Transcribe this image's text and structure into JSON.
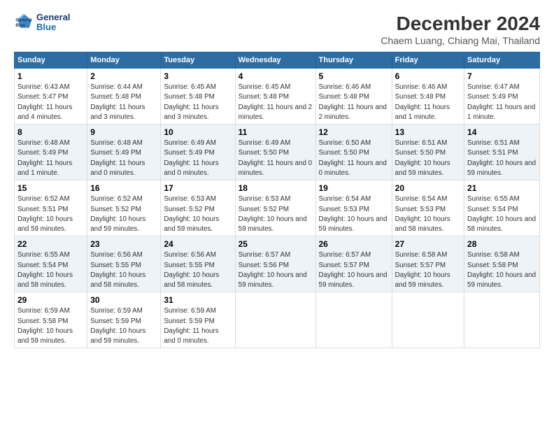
{
  "logo": {
    "line1": "General",
    "line2": "Blue"
  },
  "title": "December 2024",
  "subtitle": "Chaem Luang, Chiang Mai, Thailand",
  "days_header": [
    "Sunday",
    "Monday",
    "Tuesday",
    "Wednesday",
    "Thursday",
    "Friday",
    "Saturday"
  ],
  "weeks": [
    [
      {
        "num": "1",
        "sunrise": "6:43 AM",
        "sunset": "5:47 PM",
        "daylight": "11 hours and 4 minutes."
      },
      {
        "num": "2",
        "sunrise": "6:44 AM",
        "sunset": "5:48 PM",
        "daylight": "11 hours and 3 minutes."
      },
      {
        "num": "3",
        "sunrise": "6:45 AM",
        "sunset": "5:48 PM",
        "daylight": "11 hours and 3 minutes."
      },
      {
        "num": "4",
        "sunrise": "6:45 AM",
        "sunset": "5:48 PM",
        "daylight": "11 hours and 2 minutes."
      },
      {
        "num": "5",
        "sunrise": "6:46 AM",
        "sunset": "5:48 PM",
        "daylight": "11 hours and 2 minutes."
      },
      {
        "num": "6",
        "sunrise": "6:46 AM",
        "sunset": "5:48 PM",
        "daylight": "11 hours and 1 minute."
      },
      {
        "num": "7",
        "sunrise": "6:47 AM",
        "sunset": "5:49 PM",
        "daylight": "11 hours and 1 minute."
      }
    ],
    [
      {
        "num": "8",
        "sunrise": "6:48 AM",
        "sunset": "5:49 PM",
        "daylight": "11 hours and 1 minute."
      },
      {
        "num": "9",
        "sunrise": "6:48 AM",
        "sunset": "5:49 PM",
        "daylight": "11 hours and 0 minutes."
      },
      {
        "num": "10",
        "sunrise": "6:49 AM",
        "sunset": "5:49 PM",
        "daylight": "11 hours and 0 minutes."
      },
      {
        "num": "11",
        "sunrise": "6:49 AM",
        "sunset": "5:50 PM",
        "daylight": "11 hours and 0 minutes."
      },
      {
        "num": "12",
        "sunrise": "6:50 AM",
        "sunset": "5:50 PM",
        "daylight": "11 hours and 0 minutes."
      },
      {
        "num": "13",
        "sunrise": "6:51 AM",
        "sunset": "5:50 PM",
        "daylight": "10 hours and 59 minutes."
      },
      {
        "num": "14",
        "sunrise": "6:51 AM",
        "sunset": "5:51 PM",
        "daylight": "10 hours and 59 minutes."
      }
    ],
    [
      {
        "num": "15",
        "sunrise": "6:52 AM",
        "sunset": "5:51 PM",
        "daylight": "10 hours and 59 minutes."
      },
      {
        "num": "16",
        "sunrise": "6:52 AM",
        "sunset": "5:52 PM",
        "daylight": "10 hours and 59 minutes."
      },
      {
        "num": "17",
        "sunrise": "6:53 AM",
        "sunset": "5:52 PM",
        "daylight": "10 hours and 59 minutes."
      },
      {
        "num": "18",
        "sunrise": "6:53 AM",
        "sunset": "5:52 PM",
        "daylight": "10 hours and 59 minutes."
      },
      {
        "num": "19",
        "sunrise": "6:54 AM",
        "sunset": "5:53 PM",
        "daylight": "10 hours and 59 minutes."
      },
      {
        "num": "20",
        "sunrise": "6:54 AM",
        "sunset": "5:53 PM",
        "daylight": "10 hours and 58 minutes."
      },
      {
        "num": "21",
        "sunrise": "6:55 AM",
        "sunset": "5:54 PM",
        "daylight": "10 hours and 58 minutes."
      }
    ],
    [
      {
        "num": "22",
        "sunrise": "6:55 AM",
        "sunset": "5:54 PM",
        "daylight": "10 hours and 58 minutes."
      },
      {
        "num": "23",
        "sunrise": "6:56 AM",
        "sunset": "5:55 PM",
        "daylight": "10 hours and 58 minutes."
      },
      {
        "num": "24",
        "sunrise": "6:56 AM",
        "sunset": "5:55 PM",
        "daylight": "10 hours and 58 minutes."
      },
      {
        "num": "25",
        "sunrise": "6:57 AM",
        "sunset": "5:56 PM",
        "daylight": "10 hours and 59 minutes."
      },
      {
        "num": "26",
        "sunrise": "6:57 AM",
        "sunset": "5:57 PM",
        "daylight": "10 hours and 59 minutes."
      },
      {
        "num": "27",
        "sunrise": "6:58 AM",
        "sunset": "5:57 PM",
        "daylight": "10 hours and 59 minutes."
      },
      {
        "num": "28",
        "sunrise": "6:58 AM",
        "sunset": "5:58 PM",
        "daylight": "10 hours and 59 minutes."
      }
    ],
    [
      {
        "num": "29",
        "sunrise": "6:59 AM",
        "sunset": "5:58 PM",
        "daylight": "10 hours and 59 minutes."
      },
      {
        "num": "30",
        "sunrise": "6:59 AM",
        "sunset": "5:59 PM",
        "daylight": "10 hours and 59 minutes."
      },
      {
        "num": "31",
        "sunrise": "6:59 AM",
        "sunset": "5:59 PM",
        "daylight": "11 hours and 0 minutes."
      },
      null,
      null,
      null,
      null
    ]
  ]
}
